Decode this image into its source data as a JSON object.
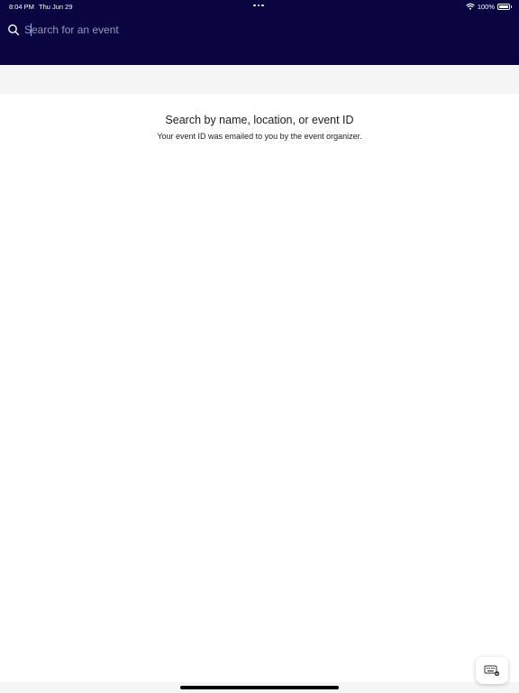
{
  "status_bar": {
    "time": "8:04 PM",
    "date": "Thu Jun 29",
    "battery": "100%"
  },
  "search": {
    "placeholder": "Search for an event",
    "value": ""
  },
  "empty_state": {
    "title": "Search by name, location, or event ID",
    "subtitle": "Your event ID was emailed to you by the event organizer."
  },
  "icons": {
    "search": "search-icon",
    "wifi": "wifi-icon",
    "battery": "battery-icon",
    "keyboard": "keyboard-icon"
  },
  "colors": {
    "header_background": "#0a0540",
    "placeholder_text": "#9a96b8",
    "band_background": "#f5f5f6"
  }
}
